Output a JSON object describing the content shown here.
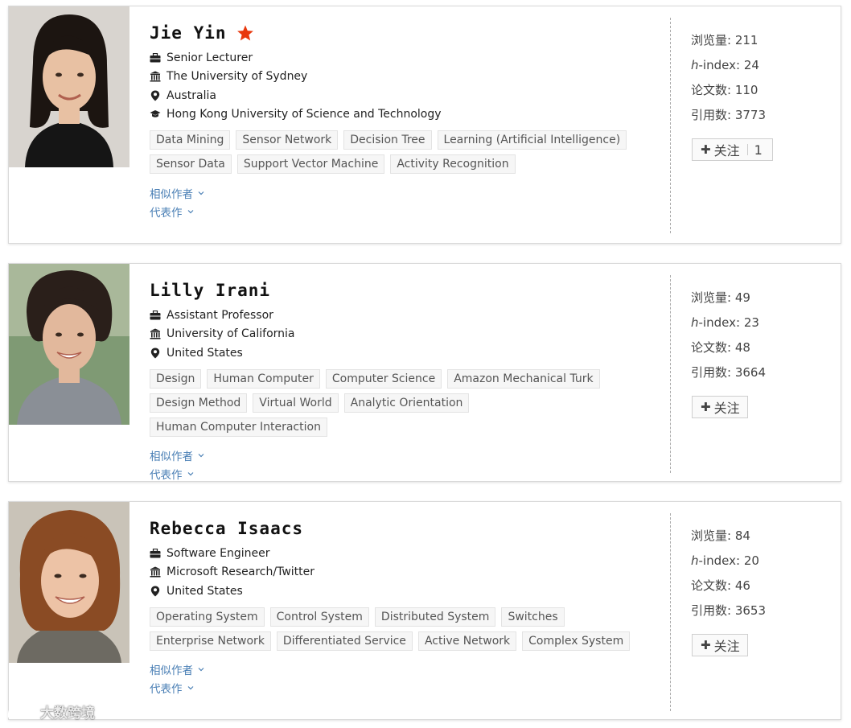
{
  "people": [
    {
      "name": "Jie Yin",
      "starred": true,
      "title": "Senior Lecturer",
      "institution": "The University of Sydney",
      "country": "Australia",
      "education": "Hong Kong University of Science and Technology",
      "tags": [
        "Data Mining",
        "Sensor Network",
        "Decision Tree",
        "Learning (Artificial Intelligence)",
        "Sensor Data",
        "Support Vector Machine",
        "Activity Recognition"
      ],
      "similar_label": "相似作者",
      "works_label": "代表作",
      "stats": {
        "views_label": "浏览量:",
        "views": "211",
        "hindex_prefix": "h",
        "hindex_label": "-index:",
        "hindex": "24",
        "papers_label": "论文数:",
        "papers": "110",
        "citations_label": "引用数:",
        "citations": "3773"
      },
      "follow_label": "关注",
      "follow_count": "1",
      "photo": {
        "bg": "#d8d4cf",
        "hair": "#1c1511",
        "skin": "#e8c1a3",
        "clothes": "#151515"
      }
    },
    {
      "name": "Lilly Irani",
      "starred": false,
      "title": "Assistant Professor",
      "institution": "University of California",
      "country": "United States",
      "tags": [
        "Design",
        "Human Computer",
        "Computer Science",
        "Amazon Mechanical Turk",
        "Design Method",
        "Virtual World",
        "Analytic Orientation",
        "Human Computer Interaction"
      ],
      "similar_label": "相似作者",
      "works_label": "代表作",
      "stats": {
        "views_label": "浏览量:",
        "views": "49",
        "hindex_prefix": "h",
        "hindex_label": "-index:",
        "hindex": "23",
        "papers_label": "论文数:",
        "papers": "48",
        "citations_label": "引用数:",
        "citations": "3664"
      },
      "follow_label": "关注",
      "photo": {
        "bg": "#7f9a74",
        "hair": "#2a1f1a",
        "skin": "#e2b89c",
        "clothes": "#8a8f96"
      }
    },
    {
      "name": "Rebecca Isaacs",
      "starred": false,
      "title": "Software Engineer",
      "institution": "Microsoft Research/Twitter",
      "country": "United States",
      "tags": [
        "Operating System",
        "Control System",
        "Distributed System",
        "Switches",
        "Enterprise Network",
        "Differentiated Service",
        "Active Network",
        "Complex System"
      ],
      "similar_label": "相似作者",
      "works_label": "代表作",
      "stats": {
        "views_label": "浏览量:",
        "views": "84",
        "hindex_prefix": "h",
        "hindex_label": "-index:",
        "hindex": "20",
        "papers_label": "论文数:",
        "papers": "46",
        "citations_label": "引用数:",
        "citations": "3653"
      },
      "follow_label": "关注",
      "photo": {
        "bg": "#c9c3b8",
        "hair": "#8a4b24",
        "skin": "#edc3a6",
        "clothes": "#6d6a62"
      }
    }
  ],
  "watermark": "大数跨境",
  "colors": {
    "star": "#e8380d",
    "link": "#4a7fb5"
  }
}
